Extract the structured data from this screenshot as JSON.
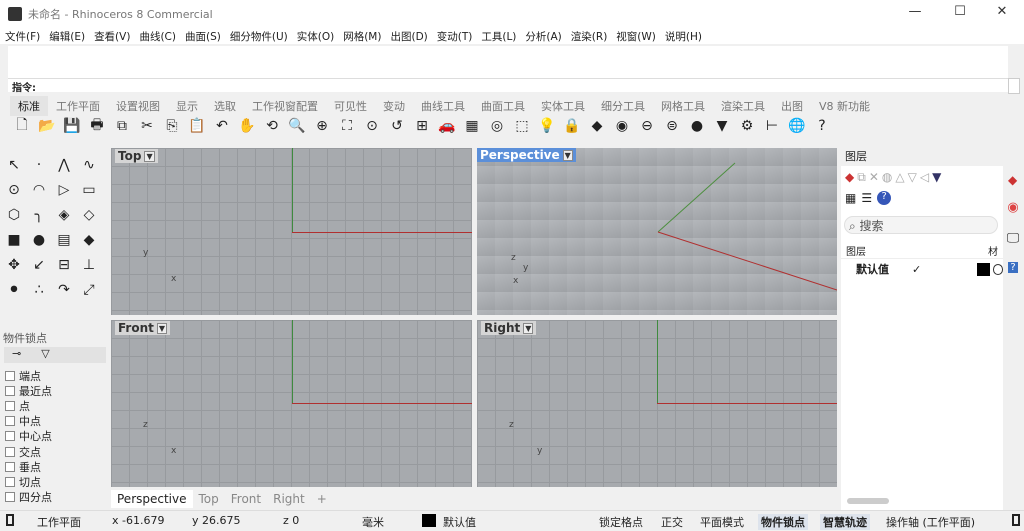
{
  "window": {
    "title": "未命名 - Rhinoceros 8 Commercial",
    "minimize": "—",
    "maximize": "☐",
    "close": "✕"
  },
  "menu": [
    "文件(F)",
    "编辑(E)",
    "查看(V)",
    "曲线(C)",
    "曲面(S)",
    "细分物件(U)",
    "实体(O)",
    "网格(M)",
    "出图(D)",
    "变动(T)",
    "工具(L)",
    "分析(A)",
    "渲染(R)",
    "视窗(W)",
    "说明(H)"
  ],
  "command": {
    "prompt": "指令:"
  },
  "tabs": [
    "标准",
    "工作平面",
    "设置视图",
    "显示",
    "选取",
    "工作视窗配置",
    "可见性",
    "变动",
    "曲线工具",
    "曲面工具",
    "实体工具",
    "细分工具",
    "网格工具",
    "渲染工具",
    "出图",
    "V8 新功能"
  ],
  "active_tab": 0,
  "toolbar_icons": [
    {
      "name": "new-icon",
      "g": "🗋"
    },
    {
      "name": "open-icon",
      "g": "📂"
    },
    {
      "name": "save-icon",
      "g": "💾"
    },
    {
      "name": "print-icon",
      "g": "🖶"
    },
    {
      "name": "import-icon",
      "g": "⧉"
    },
    {
      "name": "cut-icon",
      "g": "✂"
    },
    {
      "name": "copy-icon",
      "g": "⎘"
    },
    {
      "name": "paste-icon",
      "g": "📋"
    },
    {
      "name": "undo-icon",
      "g": "↶"
    },
    {
      "name": "pan-icon",
      "g": "✋"
    },
    {
      "name": "rotate-view-icon",
      "g": "⟲"
    },
    {
      "name": "zoom-icon",
      "g": "🔍"
    },
    {
      "name": "zoom-window-icon",
      "g": "⊕"
    },
    {
      "name": "zoom-extents-icon",
      "g": "⛶"
    },
    {
      "name": "zoom-selected-icon",
      "g": "⊙"
    },
    {
      "name": "undo-view-icon",
      "g": "↺"
    },
    {
      "name": "four-viewports-icon",
      "g": "⊞"
    },
    {
      "name": "car-icon",
      "g": "🚗"
    },
    {
      "name": "grid-icon",
      "g": "▦"
    },
    {
      "name": "target-icon",
      "g": "◎"
    },
    {
      "name": "select-icon",
      "g": "⬚"
    },
    {
      "name": "light-icon",
      "g": "💡"
    },
    {
      "name": "lock-icon",
      "g": "🔒"
    },
    {
      "name": "layer-icon",
      "g": "◆"
    },
    {
      "name": "color-wheel-icon",
      "g": "◉"
    },
    {
      "name": "sphere-wire-icon",
      "g": "⊖"
    },
    {
      "name": "sphere-box-icon",
      "g": "⊜"
    },
    {
      "name": "render-sphere-icon",
      "g": "●"
    },
    {
      "name": "cone-icon",
      "g": "▼"
    },
    {
      "name": "gear-icon",
      "g": "⚙"
    },
    {
      "name": "dimension-icon",
      "g": "⊢"
    },
    {
      "name": "globe-icon",
      "g": "🌐"
    },
    {
      "name": "help-icon",
      "g": "?"
    }
  ],
  "left_tools": [
    {
      "name": "select-arrow-icon",
      "g": "↖"
    },
    {
      "name": "point-icon",
      "g": "·"
    },
    {
      "name": "polyline-icon",
      "g": "⋀"
    },
    {
      "name": "curve-icon",
      "g": "∿"
    },
    {
      "name": "circle-icon",
      "g": "⊙"
    },
    {
      "name": "arc-icon",
      "g": "◠"
    },
    {
      "name": "triangle-icon",
      "g": "▷"
    },
    {
      "name": "rectangle-icon",
      "g": "▭"
    },
    {
      "name": "polygon-icon",
      "g": "⬡"
    },
    {
      "name": "fillet-icon",
      "g": "╮"
    },
    {
      "name": "surface-icon",
      "g": "◈"
    },
    {
      "name": "loft-icon",
      "g": "◇"
    },
    {
      "name": "box-icon",
      "g": "■"
    },
    {
      "name": "spheres-icon",
      "g": "●"
    },
    {
      "name": "cylinder-icon",
      "g": "▤"
    },
    {
      "name": "mesh-icon",
      "g": "◆"
    },
    {
      "name": "transform-icon",
      "g": "✥"
    },
    {
      "name": "orange-arrow-icon",
      "g": "↙"
    },
    {
      "name": "split-icon",
      "g": "⊟"
    },
    {
      "name": "move-icon",
      "g": "⊥"
    },
    {
      "name": "group-icon",
      "g": "⚫"
    },
    {
      "name": "dots-icon",
      "g": "∴"
    },
    {
      "name": "rotate-icon",
      "g": "↷"
    },
    {
      "name": "scale-icon",
      "g": "⤢"
    }
  ],
  "osnap": {
    "title": "物件锁点",
    "items": [
      "端点",
      "最近点",
      "点",
      "中点",
      "中心点",
      "交点",
      "垂点",
      "切点",
      "四分点"
    ]
  },
  "viewports": [
    {
      "name": "Top",
      "active": false
    },
    {
      "name": "Perspective",
      "active": true
    },
    {
      "name": "Front",
      "active": false
    },
    {
      "name": "Right",
      "active": false
    }
  ],
  "viewport_tabs": [
    "Perspective",
    "Top",
    "Front",
    "Right",
    "+"
  ],
  "layers_panel": {
    "title": "图层",
    "search_placeholder": "搜索",
    "col_layer": "图层",
    "col_material": "材",
    "rows": [
      {
        "name": "默认值",
        "current": "✓",
        "color": "#000000"
      }
    ]
  },
  "status": {
    "cplane": "工作平面",
    "x": "x -61.679",
    "y": "y 26.675",
    "z": "z 0",
    "units": "毫米",
    "layer": "默认值",
    "snap": "锁定格点",
    "ortho": "正交",
    "planar": "平面模式",
    "osnap": "物件锁点",
    "smarttrack": "智慧轨迹",
    "gumball": "操作轴 (工作平面)"
  }
}
